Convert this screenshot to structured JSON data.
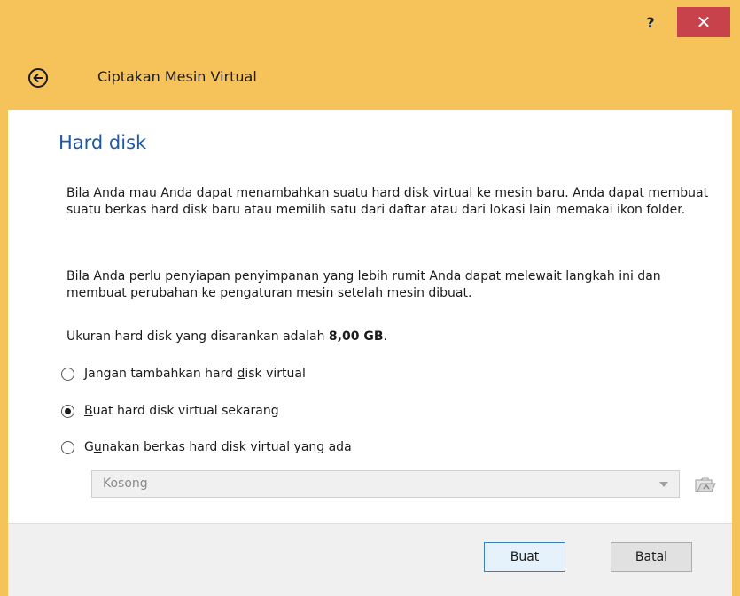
{
  "titlebar": {
    "help_label": "?",
    "close_label": "✕"
  },
  "header": {
    "title": "Ciptakan Mesin Virtual"
  },
  "page": {
    "title": "Hard disk",
    "paragraph1": "Bila Anda mau Anda dapat menambahkan suatu hard disk virtual ke mesin baru. Anda dapat membuat suatu berkas hard disk baru atau memilih satu dari daftar atau dari lokasi lain memakai ikon folder.",
    "paragraph2": "Bila Anda perlu penyiapan penyimpanan yang lebih rumit Anda dapat melewait langkah ini dan membuat perubahan ke pengaturan mesin setelah mesin dibuat.",
    "recommended_prefix": "Ukuran hard disk yang disarankan adalah ",
    "recommended_size": "8,00 GB",
    "recommended_suffix": "."
  },
  "options": [
    {
      "pre": "Jangan tambahkan hard ",
      "mnemonic": "d",
      "post": "isk virtual",
      "selected": false
    },
    {
      "pre": "",
      "mnemonic": "B",
      "post": "uat hard disk virtual sekarang",
      "selected": true
    },
    {
      "pre": "G",
      "mnemonic": "u",
      "post": "nakan berkas hard disk virtual yang ada",
      "selected": false
    }
  ],
  "disk_select": {
    "value": "Kosong",
    "enabled": false
  },
  "footer": {
    "create_label": "Buat",
    "cancel_label": "Batal"
  },
  "colors": {
    "frame": "#f6c35a",
    "close_button": "#c7424a",
    "title_blue": "#1e5aa8"
  }
}
